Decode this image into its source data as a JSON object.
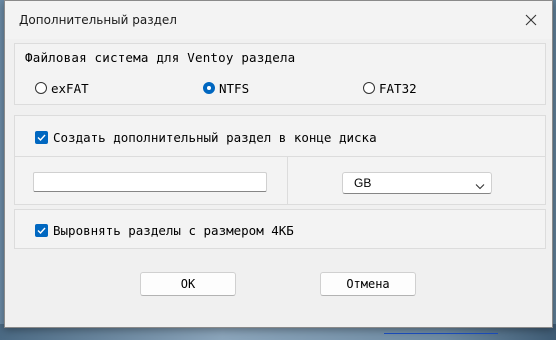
{
  "window": {
    "title": "Дополнительный раздел"
  },
  "filesystem": {
    "label": "Файловая система для Ventoy раздела",
    "options": [
      {
        "label": "exFAT",
        "selected": false
      },
      {
        "label": "NTFS",
        "selected": true
      },
      {
        "label": "FAT32",
        "selected": false
      }
    ]
  },
  "partition": {
    "create_label": "Создать дополнительный раздел в конце диска",
    "create_checked": true,
    "size_value": "",
    "unit_value": "GB"
  },
  "align": {
    "label": "Выровнять разделы с размером 4КБ",
    "checked": true
  },
  "buttons": {
    "ok_label": "OK",
    "cancel_label": "Отмена"
  },
  "colors": {
    "accent": "#0067c0",
    "dialog_bg": "#f0f0f0"
  }
}
